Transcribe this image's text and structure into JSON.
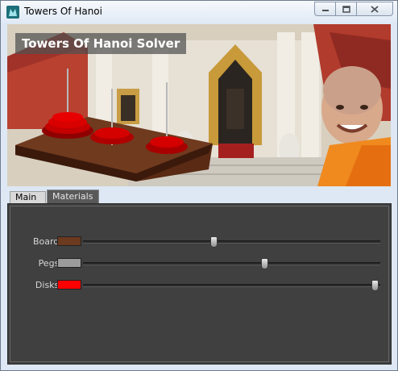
{
  "window": {
    "title": "Towers Of Hanoi",
    "buttons": {
      "minimize": "minimize-icon",
      "maximize": "maximize-icon",
      "close": "close-icon"
    }
  },
  "banner": {
    "title": "Towers Of Hanoi Solver"
  },
  "tabs": [
    {
      "label": "Main",
      "selected": false
    },
    {
      "label": "Materials",
      "selected": true
    }
  ],
  "materials": [
    {
      "label": "Board:",
      "color": "#6b3a1f",
      "level": 0.44
    },
    {
      "label": "Pegs:",
      "color": "#9b9b9b",
      "level": 0.61
    },
    {
      "label": "Disks:",
      "color": "#ff0000",
      "level": 0.98
    }
  ]
}
